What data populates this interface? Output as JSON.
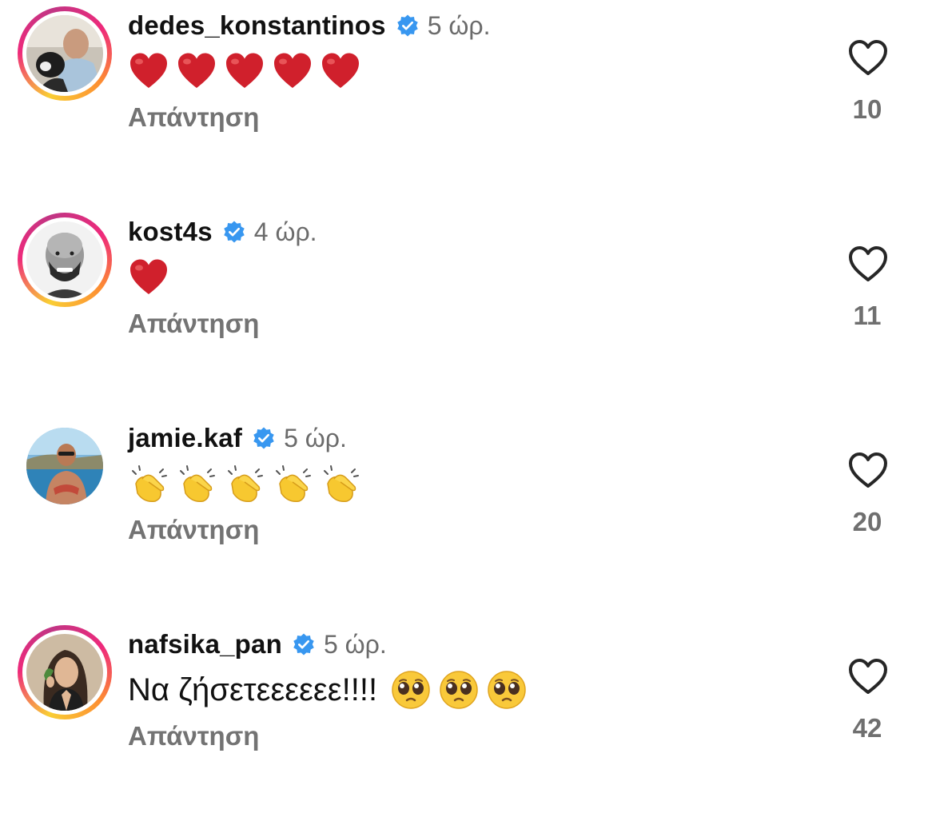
{
  "comments": [
    {
      "username": "dedes_konstantinos",
      "verified": true,
      "time": "5 ώρ.",
      "text": "",
      "emojis": [
        "red-heart",
        "red-heart",
        "red-heart",
        "red-heart",
        "red-heart"
      ],
      "reply_label": "Απάντηση",
      "likes": "10",
      "story_ring": true
    },
    {
      "username": "kost4s",
      "verified": true,
      "time": "4 ώρ.",
      "text": "",
      "emojis": [
        "red-heart"
      ],
      "reply_label": "Απάντηση",
      "likes": "11",
      "story_ring": true
    },
    {
      "username": "jamie.kaf",
      "verified": true,
      "time": "5 ώρ.",
      "text": "",
      "emojis": [
        "clapping-hands",
        "clapping-hands",
        "clapping-hands",
        "clapping-hands",
        "clapping-hands"
      ],
      "reply_label": "Απάντηση",
      "likes": "20",
      "story_ring": false
    },
    {
      "username": "nafsika_pan",
      "verified": true,
      "time": "5 ώρ.",
      "text": "Να ζήσετεεεεεε!!!!",
      "emojis": [
        "pleading-face",
        "pleading-face",
        "pleading-face"
      ],
      "reply_label": "Απάντηση",
      "likes": "42",
      "story_ring": true
    }
  ],
  "colors": {
    "verified_badge": "#3897f0",
    "secondary_text": "#737373",
    "heart_emoji": "#d0202c",
    "like_outline": "#262626"
  }
}
